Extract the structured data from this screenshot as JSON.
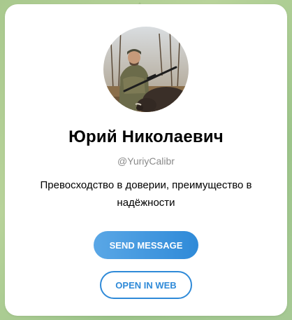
{
  "profile": {
    "name": "Юрий Николаевич",
    "username": "@YuriyCalibr",
    "bio": "Превосходство в доверии, преимущество в надёжности",
    "avatar_icon": "profile-photo-hunter-icon"
  },
  "actions": {
    "send_message_label": "SEND MESSAGE",
    "open_in_web_label": "OPEN IN WEB"
  },
  "colors": {
    "accent": "#2f8ad8",
    "accent_light": "#5aa7e6",
    "background": "#a9c98e",
    "username_gray": "#8a8a8a"
  }
}
